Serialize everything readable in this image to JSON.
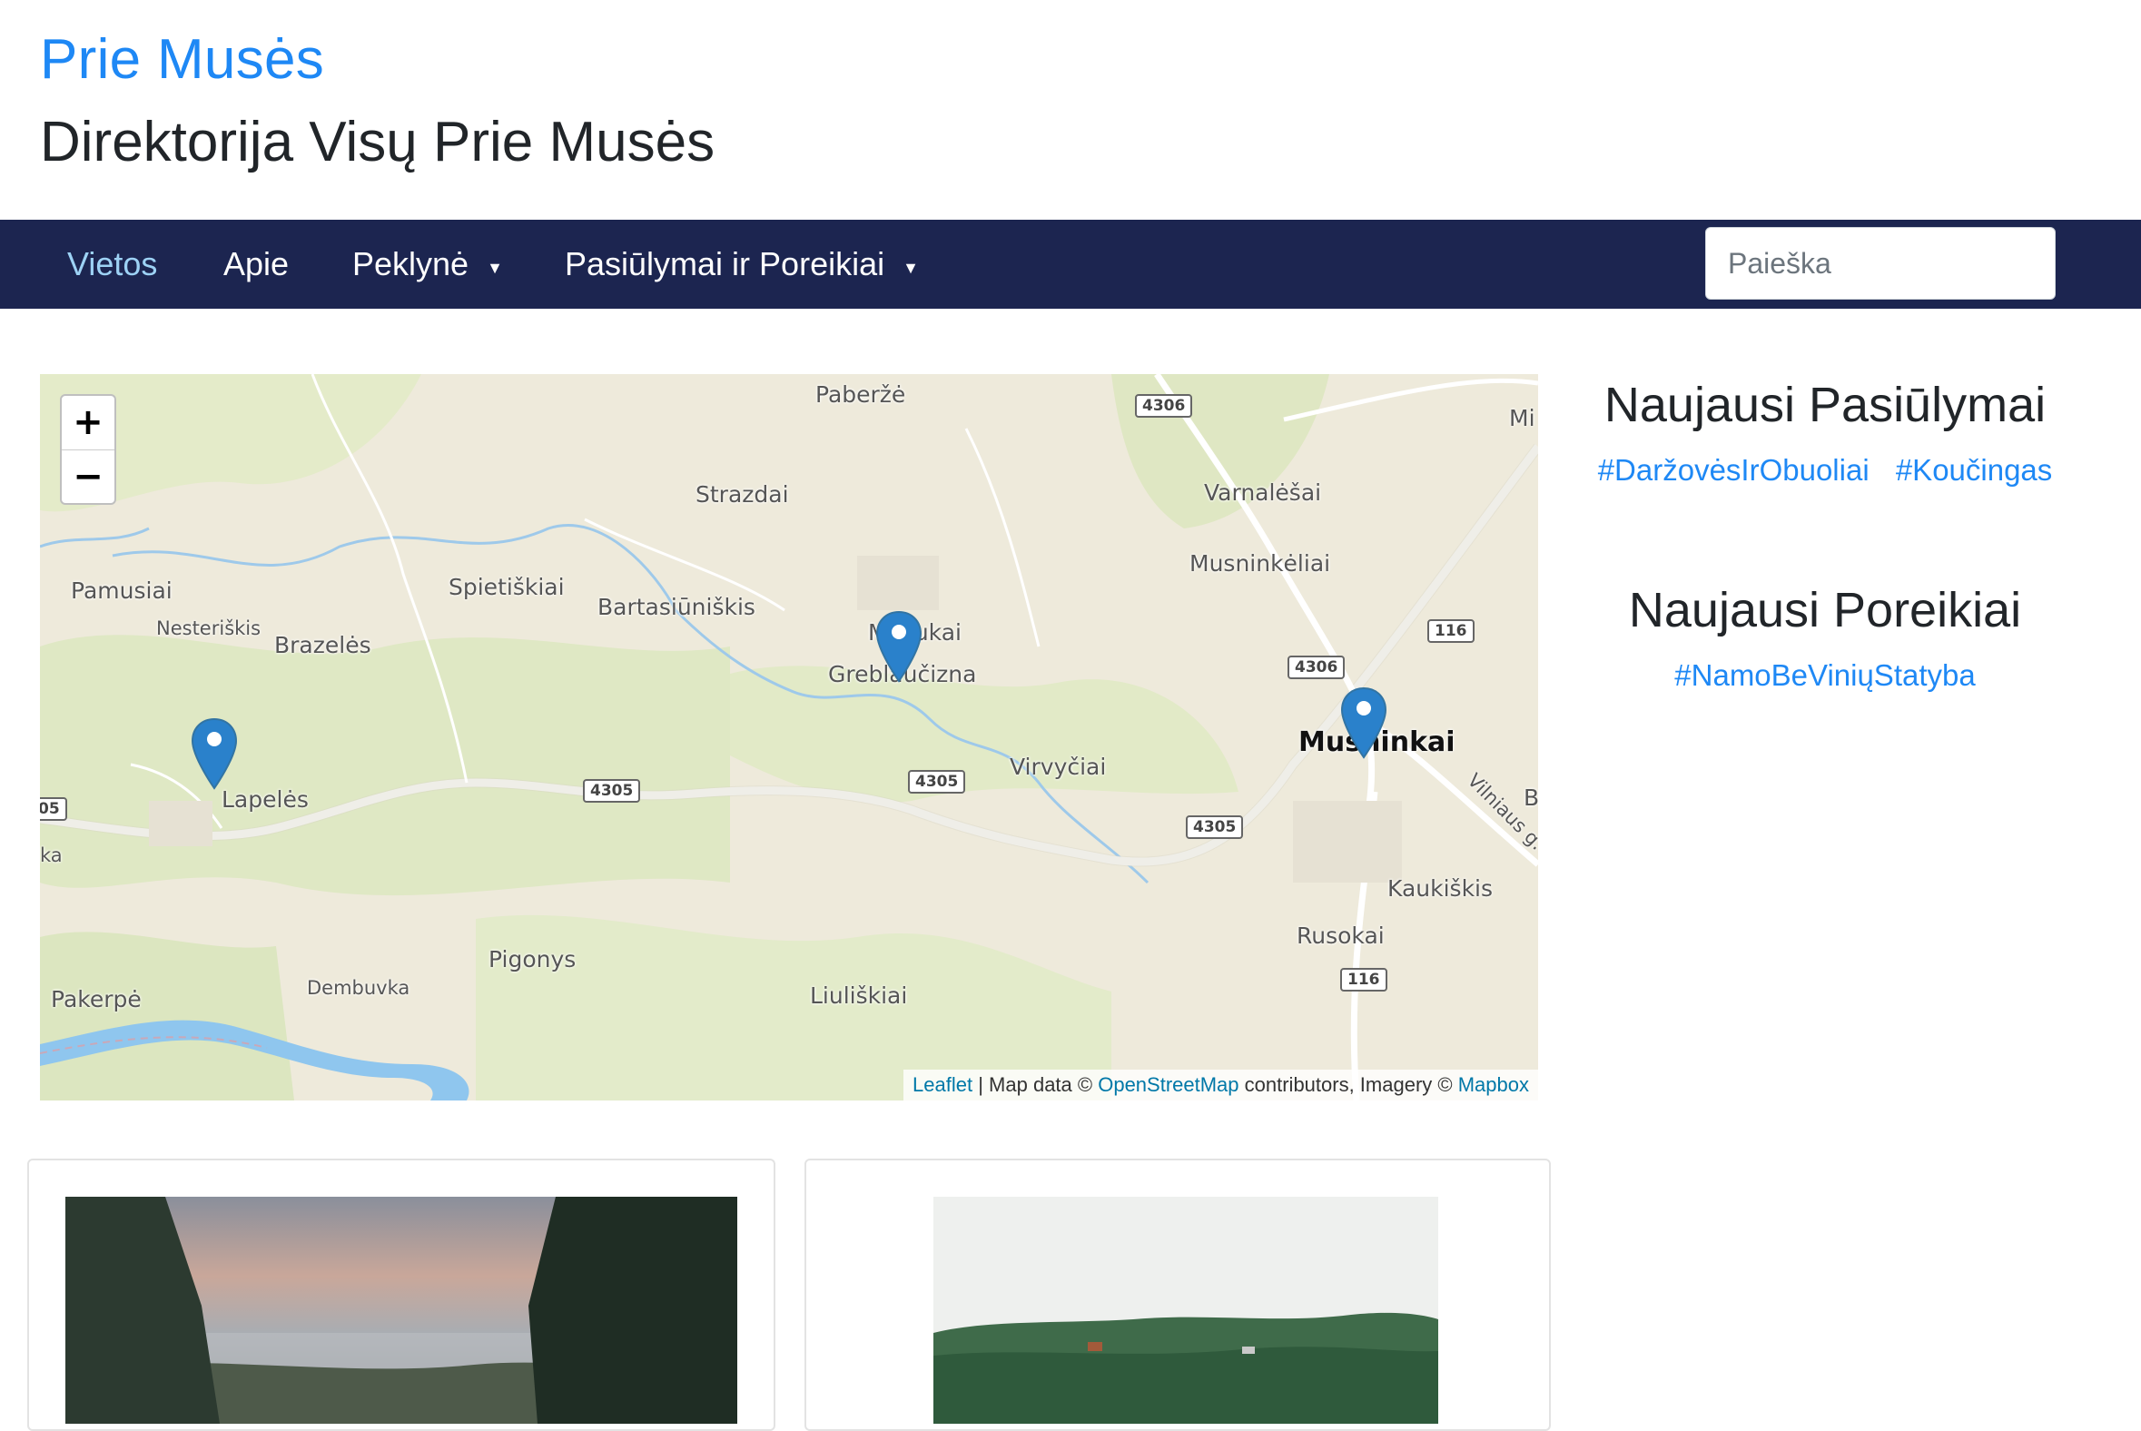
{
  "header": {
    "site_title": "Prie Musės",
    "subtitle": "Direktorija Visų Prie Musės"
  },
  "nav": {
    "items": [
      {
        "label": "Vietos",
        "active": true,
        "dropdown": false
      },
      {
        "label": "Apie",
        "active": false,
        "dropdown": false
      },
      {
        "label": "Peklynė",
        "active": false,
        "dropdown": true
      },
      {
        "label": "Pasiūlymai ir Poreikiai",
        "active": false,
        "dropdown": true
      }
    ],
    "caret": "▼",
    "search_placeholder": "Paieška"
  },
  "map": {
    "zoom_in": "+",
    "zoom_out": "−",
    "places": [
      "Paberžė",
      "Strazdai",
      "Varnalėšai",
      "Musninkėliai",
      "Pamusiai",
      "Spietiškiai",
      "Bartasiūniškis",
      "Nesteriškis",
      "Brazelės",
      "Mėliukai",
      "Greblaučizna",
      "Lapelės",
      "Virvyčiai",
      "Musninkai",
      "Vilniaus g.",
      "Kaukiškis",
      "Rusokai",
      "Pigonys",
      "Dembuvka",
      "Pakerpė",
      "Liuliškiai",
      "Mi",
      "B",
      "ka"
    ],
    "road_shields": [
      "4306",
      "4306",
      "116",
      "4305",
      "4305",
      "4305",
      "116",
      "05"
    ],
    "attribution": {
      "leaflet": "Leaflet",
      "sep": " | Map data © ",
      "osm": "OpenStreetMap",
      "mid": " contributors, Imagery © ",
      "mapbox": "Mapbox"
    }
  },
  "sidebar": {
    "offers_title": "Naujausi Pasiūlymai",
    "offers_tags": [
      "#DaržovėsIrObuoliai",
      "#Koučingas"
    ],
    "needs_title": "Naujausi Poreikiai",
    "needs_tags": [
      "#NamoBeViniųStatyba"
    ]
  },
  "colors": {
    "brand": "#1e88f5",
    "navbar": "#1c2550",
    "nav_active": "#9dd2f5",
    "marker": "#2a81cb"
  }
}
